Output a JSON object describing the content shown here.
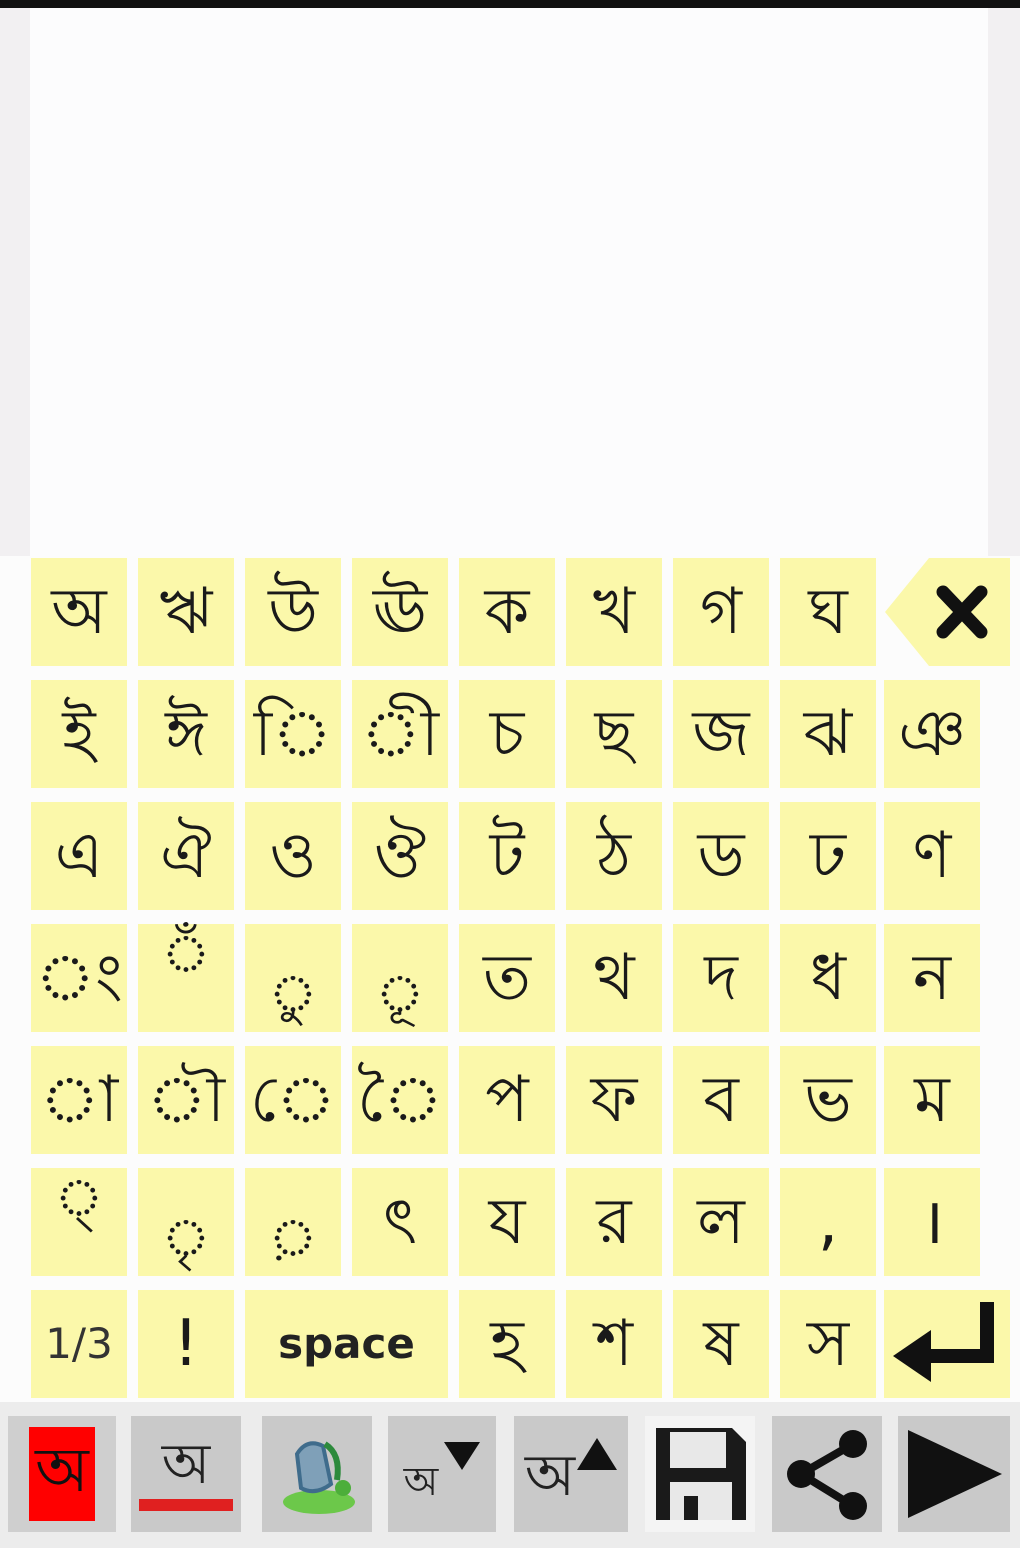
{
  "editor": {
    "text": "",
    "placeholder": ""
  },
  "keyboard": {
    "rows": [
      [
        "অ",
        "ঋ",
        "উ",
        "ঊ",
        "ক",
        "খ",
        "গ",
        "ঘ"
      ],
      [
        "ই",
        "ঈ",
        "ি",
        "ী",
        "চ",
        "ছ",
        "জ",
        "ঝ",
        "ঞ"
      ],
      [
        "এ",
        "ঐ",
        "ও",
        "ঔ",
        "ট",
        "ঠ",
        "ড",
        "ঢ",
        "ণ"
      ],
      [
        "ং",
        "ঁ",
        "ু",
        "ূ",
        "ত",
        "থ",
        "দ",
        "ধ",
        "ন"
      ],
      [
        "া",
        "ৗ",
        "ে",
        "ৈ",
        "প",
        "ফ",
        "ব",
        "ভ",
        "ম"
      ],
      [
        "্",
        "ৃ",
        "়",
        "ৎ",
        "য",
        "র",
        "ল",
        ",",
        "।"
      ],
      [
        "1/3",
        "!",
        "space",
        "হ",
        "শ",
        "ষ",
        "স"
      ]
    ]
  },
  "toolbar": {
    "bangla_toggle": "অ",
    "font_label": "অ",
    "font_down_label": "অ",
    "font_up_label": "অ"
  },
  "colors": {
    "key_bg": "#fbf8aa",
    "accent_red": "#ff0000"
  }
}
